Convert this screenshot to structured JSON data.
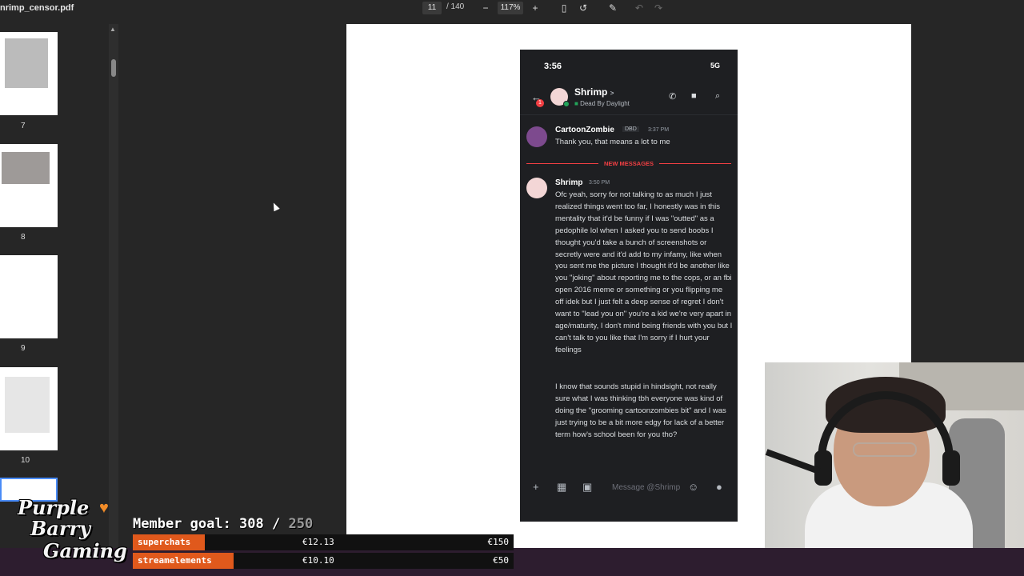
{
  "toolbar": {
    "filename": "nrimp_censor.pdf",
    "current_page": "11",
    "page_count": "/ 140",
    "zoom": "117%",
    "zoom_out_icon": "minus-icon",
    "zoom_in_icon": "plus-icon"
  },
  "sidebar": {
    "thumbnails": [
      {
        "num": "7"
      },
      {
        "num": "8"
      },
      {
        "num": "9"
      },
      {
        "num": "10"
      }
    ]
  },
  "phone": {
    "status_time": "3:56",
    "status_right": "5G",
    "header": {
      "name": "Shrimp",
      "chevron": ">",
      "subtitle": "Dead By Daylight",
      "badge": "1"
    },
    "messages": [
      {
        "author": "CartoonZombie",
        "tag": "DBD",
        "time": "3:37 PM",
        "text": "Thank you, that means a lot to me"
      }
    ],
    "new_messages_label": "NEW MESSAGES",
    "shrimp_message": {
      "author": "Shrimp",
      "time": "3:50 PM",
      "paragraph1": "Ofc yeah, sorry for not talking to as much I just realized things went too far, I honestly was in this mentality that it'd be funny if I was \"outted\" as a pedophile lol when I asked you to send boobs I thought you'd take a bunch of screenshots or secretly were and it'd add to my infamy, like when you sent me the picture I thought it'd be another like you \"joking\" about reporting me to the cops, or an fbi open 2016 meme or something or you flipping me off idek but I just felt a deep sense of regret I don't want to \"lead you on\" you're a kid we're very apart in age/maturity, I don't mind being friends with you but I can't talk to you like that I'm sorry if I hurt your feelings",
      "paragraph2": "I know that sounds stupid in hindsight, not really sure what I was thinking tbh everyone was kind of doing the \"grooming cartoonzombies bit\" and I was just trying to be a bit more edgy for lack of a better term how's school been for you tho?"
    },
    "composer_placeholder": "Message @Shrimp"
  },
  "overlay": {
    "logo_line1": "Purple",
    "logo_line2": "Barry",
    "logo_line3": "Gaming",
    "goal_label": "Member goal: 308 /",
    "goal_target": "250",
    "rows": [
      {
        "label": "superchats",
        "amount": "€12.13",
        "goal": "€150"
      },
      {
        "label": "streamelements",
        "amount": "€10.10",
        "goal": "€50"
      }
    ]
  }
}
